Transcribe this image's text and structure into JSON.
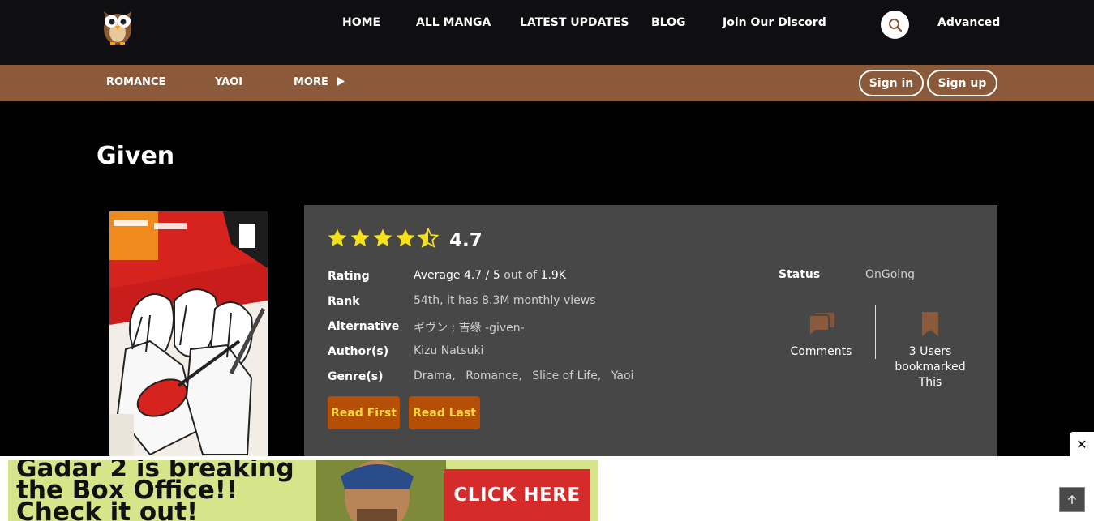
{
  "header": {
    "nav": [
      "HOME",
      "ALL MANGA",
      "LATEST UPDATES",
      "BLOG",
      "Join Our Discord"
    ],
    "advanced_label": "Advanced"
  },
  "subnav": {
    "items": [
      "ROMANCE",
      "YAOI",
      "MORE"
    ],
    "sign_in": "Sign in",
    "sign_up": "Sign up"
  },
  "manga": {
    "title": "Given",
    "score": "4.7",
    "stars_rating": 4.7,
    "rows": {
      "rating_label": "Rating",
      "rating_prefix": "Average",
      "rating_value": "4.7",
      "rating_sep": "/",
      "rating_max": "5",
      "rating_outof": "out of",
      "rating_count": "1.9K",
      "rank_label": "Rank",
      "rank_value": "54th, it has 8.3M monthly views",
      "alt_label": "Alternative",
      "alt_value": "ギヴン ; 吉缘 -given-",
      "author_label": "Author(s)",
      "author_value": "Kizu Natsuki",
      "genre_label": "Genre(s)",
      "genres": [
        "Drama,",
        "Romance,",
        "Slice of Life,",
        "Yaoi"
      ]
    },
    "read_first": "Read First",
    "read_last": "Read Last",
    "status_label": "Status",
    "status_value": "OnGoing",
    "comments_label": "Comments",
    "bookmark_line1": "3 Users",
    "bookmark_line2": "bookmarked",
    "bookmark_line3": "This"
  },
  "ad": {
    "line1": "Gadar 2 is breaking",
    "line2": "the Box Office!!",
    "line3": "Check it out!",
    "cta": "CLICK HERE",
    "close": "✕"
  },
  "colors": {
    "subbar": "#8b5a3a",
    "star": "#f5e11a",
    "button": "#b54f06",
    "button_text": "#ffd73b",
    "icon": "#8b5a3a"
  }
}
